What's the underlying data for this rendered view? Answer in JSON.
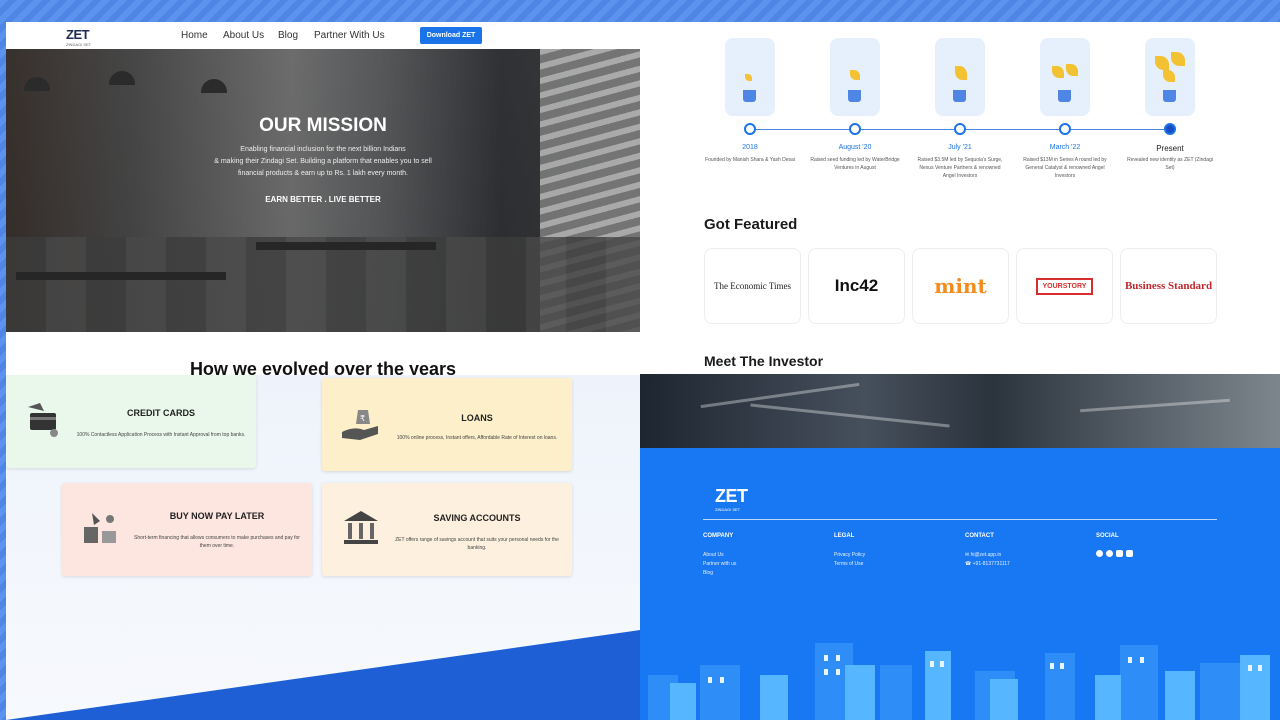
{
  "header": {
    "logo": "ZET",
    "logo_sub": "ZINDAGI SET",
    "nav": [
      "Home",
      "About Us",
      "Blog",
      "Partner With Us"
    ],
    "cta": "Download ZET"
  },
  "hero": {
    "title": "OUR MISSION",
    "lines": [
      "Enabling financial inclusion for the next billion Indians",
      "& making their Zindagi Set. Building a platform that enables you to sell",
      "financial products & earn up to Rs. 1 lakh every month."
    ],
    "tagline": "EARN BETTER . LIVE BETTER"
  },
  "evolution": {
    "title": "How we evolved over the years",
    "milestones": [
      {
        "year": "2018",
        "desc": "Founded by Manish Shara & Yash Desai"
      },
      {
        "year": "August '20",
        "desc": "Raised seed funding led by WaterBridge Ventures in August"
      },
      {
        "year": "July '21",
        "desc": "Raised $3.5M led by Sequoia's Surge, Nexus Venture Partners & renowned Angel Investors"
      },
      {
        "year": "March '22",
        "desc": "Raised $13M in Series A round led by General Catalyst & renowned Angel Investors"
      },
      {
        "year": "Present",
        "desc": "Revealed new identity as ZET (Zindagi Set)"
      }
    ]
  },
  "featured": {
    "title": "Got Featured",
    "logos": [
      "The Economic Times",
      "Inc42",
      "mint",
      "YOURSTORY",
      "Business Standard"
    ]
  },
  "investor": {
    "title": "Meet The Investor"
  },
  "products": [
    {
      "title": "CREDIT CARDS",
      "desc": "100% Contactless Application Process with Instant Approval from top banks.",
      "bg": "#e9f8ea"
    },
    {
      "title": "LOANS",
      "desc": "100% online process, Instant offers, Affordable Rate of Interest on loans.",
      "bg": "#fcefc9"
    },
    {
      "title": "BUY NOW PAY LATER",
      "desc": "Short-term financing that allows consumers to make purchases and pay for them over time.",
      "bg": "#fde5e0"
    },
    {
      "title": "SAVING ACCOUNTS",
      "desc": "ZET offers range of savings account that suits your personal needs for the banking.",
      "bg": "#fdf0de"
    }
  ],
  "footer": {
    "logo": "ZET",
    "logo_sub": "ZINDAGI SET",
    "columns": [
      {
        "head": "COMPANY",
        "links": [
          "About Us",
          "Partner with us",
          "Blog"
        ]
      },
      {
        "head": "LEGAL",
        "links": [
          "Privacy Policy",
          "Terms of Use"
        ]
      },
      {
        "head": "CONTACT",
        "links": [
          "hi@zet.app.in",
          "+91-8137731117"
        ]
      },
      {
        "head": "SOCIAL",
        "links": []
      }
    ]
  },
  "colors": {
    "primary": "#1a73e8",
    "footer_bg": "#1877f2",
    "accent": "#f2c233"
  }
}
